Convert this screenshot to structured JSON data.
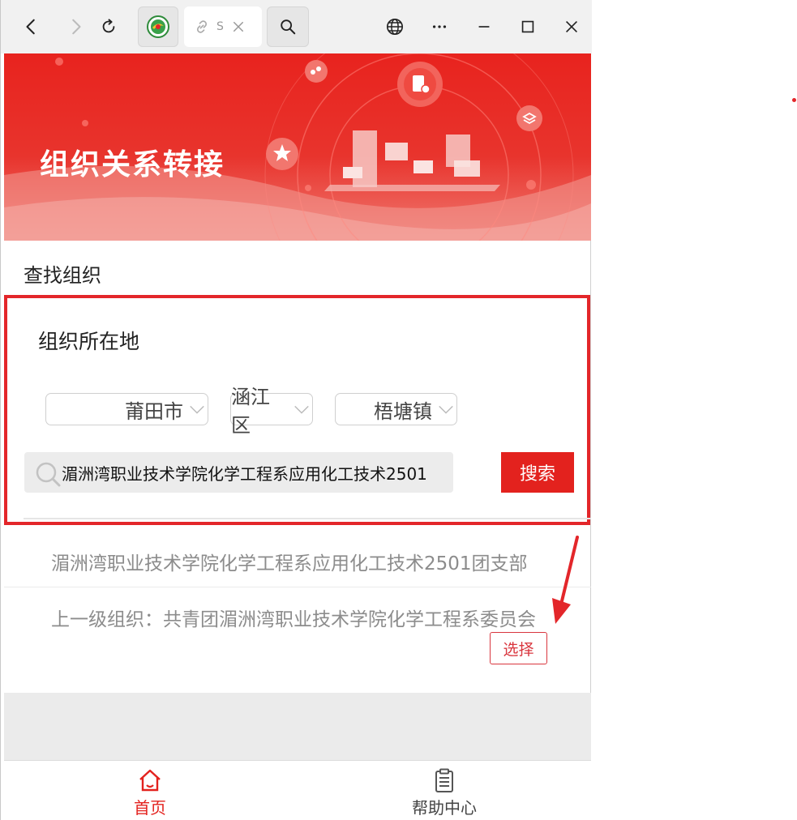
{
  "browser": {
    "tab_title": "S",
    "colors": {
      "chrome_bg": "#f1f1f1"
    }
  },
  "banner": {
    "title": "组织关系转接"
  },
  "search": {
    "section_title": "查找组织",
    "location_label": "组织所在地",
    "city": "莆田市",
    "district": "涵江区",
    "town": "梧塘镇",
    "query": "湄洲湾职业技术学院化学工程系应用化工技术2501",
    "button_label": "搜索"
  },
  "result": {
    "name": "湄洲湾职业技术学院化学工程系应用化工技术2501团支部",
    "parent_label": "上一级组织：",
    "parent_name": "共青团湄洲湾职业技术学院化学工程系委员会",
    "choose_label": "选择"
  },
  "tabbar": {
    "items": [
      {
        "label": "首页",
        "icon": "home-icon",
        "active": true
      },
      {
        "label": "帮助中心",
        "icon": "clipboard-icon",
        "active": false
      }
    ]
  },
  "colors": {
    "accent": "#e3221e",
    "annotation": "#e3262a",
    "muted_text": "#8c8c8c"
  }
}
